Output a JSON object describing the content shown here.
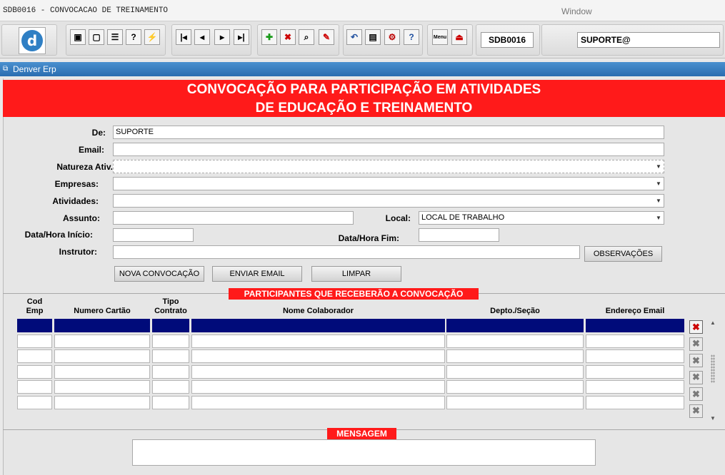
{
  "window": {
    "title": "SDB0016 - CONVOCACAO DE TREINAMENTO",
    "menu_label": "Window"
  },
  "toolbar": {
    "logo_letter": "d",
    "form_code": "SDB0016",
    "user": "SUPORTE@",
    "menu_icon_label": "Menu"
  },
  "app": {
    "name": "Denver Erp"
  },
  "banner": {
    "line1": "CONVOCAÇÃO PARA PARTICIPAÇÃO EM ATIVIDADES",
    "line2": "DE EDUCAÇÃO E TREINAMENTO"
  },
  "form": {
    "de_label": "De:",
    "de_value": "SUPORTE",
    "email_label": "Email:",
    "email_value": "",
    "natureza_label": "Natureza Ativ.:",
    "natureza_value": "",
    "empresas_label": "Empresas:",
    "empresas_value": "",
    "atividades_label": "Atividades:",
    "atividades_value": "",
    "assunto_label": "Assunto:",
    "assunto_value": "",
    "local_label": "Local:",
    "local_value": "LOCAL DE TRABALHO",
    "inicio_label": "Data/Hora Início:",
    "inicio_value": "",
    "fim_label": "Data/Hora Fim:",
    "fim_value": "",
    "instrutor_label": "Instrutor:",
    "instrutor_value": "",
    "observacoes_button": "OBSERVAÇÕES",
    "nova_button": "NOVA CONVOCAÇÃO",
    "enviar_button": "ENVIAR EMAIL",
    "limpar_button": "LIMPAR"
  },
  "participants": {
    "section_title": "PARTICIPANTES QUE RECEBERÃO A CONVOCAÇÃO",
    "columns": {
      "cod_emp_1": "Cod",
      "cod_emp_2": "Emp",
      "cartao": "Numero Cartão",
      "tipo_1": "Tipo",
      "tipo_2": "Contrato",
      "nome": "Nome Colaborador",
      "depto": "Depto./Seção",
      "email": "Endereço Email"
    },
    "row_count": 6,
    "selected_row": 1
  },
  "message": {
    "section_title": "MENSAGEM",
    "text": ""
  }
}
